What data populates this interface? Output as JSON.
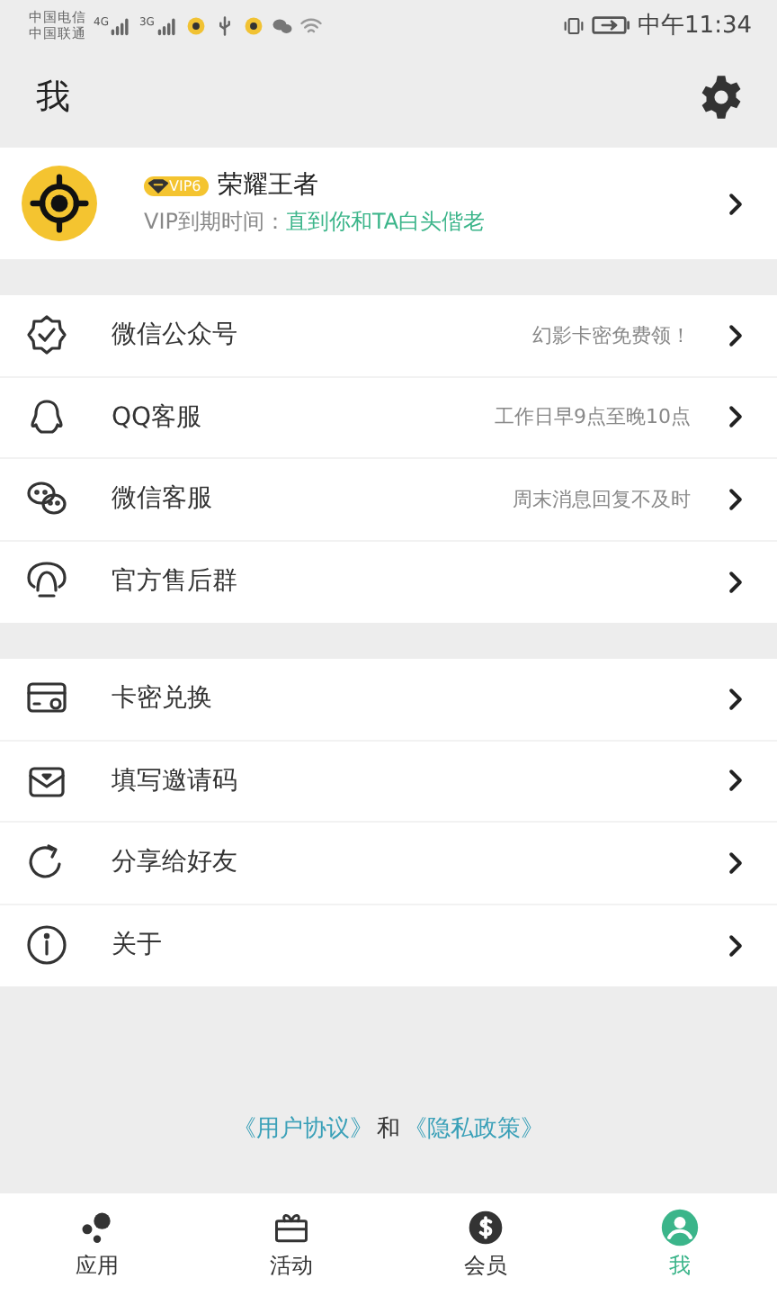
{
  "status_bar": {
    "carriers": [
      "中国电信",
      "中国联通"
    ],
    "networks": [
      "4G",
      "3G"
    ],
    "time": "中午11:34"
  },
  "header": {
    "title": "我"
  },
  "profile": {
    "badge": "VIP6",
    "name": "荣耀王者",
    "expiry_label": "VIP到期时间：",
    "expiry_value": "直到你和TA白头偕老"
  },
  "groups": [
    [
      {
        "label": "微信公众号",
        "note": "幻影卡密免费领！"
      },
      {
        "label": "QQ客服",
        "note": "工作日早9点至晚10点"
      },
      {
        "label": "微信客服",
        "note": "周末消息回复不及时"
      },
      {
        "label": "官方售后群"
      }
    ],
    [
      {
        "label": "卡密兑换"
      },
      {
        "label": "填写邀请码"
      },
      {
        "label": "分享给好友"
      },
      {
        "label": "关于"
      }
    ]
  ],
  "footer": {
    "links": [
      "《用户协议》",
      "《隐私政策》"
    ],
    "joiner": "和"
  },
  "tabs": [
    {
      "label": "应用",
      "selected": false
    },
    {
      "label": "活动",
      "selected": false
    },
    {
      "label": "会员",
      "selected": false
    },
    {
      "label": "我",
      "selected": true
    }
  ]
}
